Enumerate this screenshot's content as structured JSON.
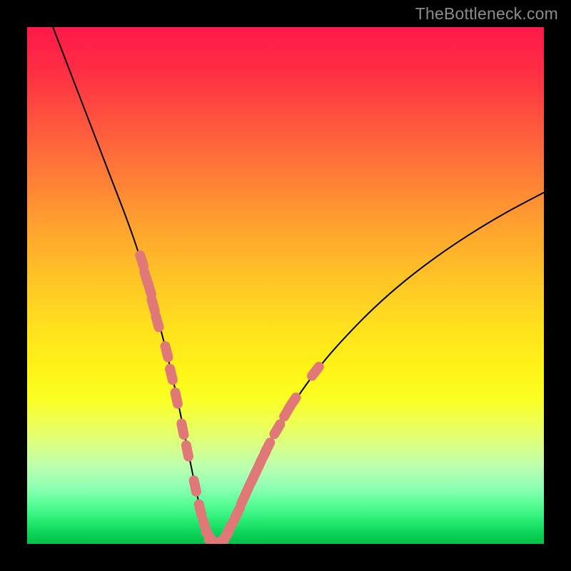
{
  "watermark": "TheBottleneck.com",
  "colors": {
    "curve_stroke": "#000000",
    "marker_fill": "#e07878",
    "marker_stroke": "#e07878"
  },
  "chart_data": {
    "type": "line",
    "title": "",
    "xlabel": "",
    "ylabel": "",
    "xlim": [
      0,
      100
    ],
    "ylim": [
      0,
      100
    ],
    "series": [
      {
        "name": "curve",
        "x": [
          5,
          7,
          9,
          11,
          13,
          15,
          17,
          19,
          21,
          22.5,
          24,
          25.5,
          27,
          28.5,
          29.7,
          30.7,
          31.7,
          32.7,
          33.6,
          34.4,
          35.2,
          36,
          36.8,
          37.6,
          38.6,
          39.8,
          41.2,
          43,
          45,
          47.5,
          50.5,
          54,
          58,
          62.5,
          67.5,
          73,
          79,
          85.5,
          92.5,
          100
        ],
        "values": [
          100,
          94.8,
          89.6,
          84.4,
          79.2,
          74,
          68.8,
          63.6,
          58,
          53.2,
          48.2,
          42.8,
          37,
          30.6,
          25,
          20,
          15.2,
          10.4,
          6.4,
          3.6,
          1.6,
          0.6,
          0.2,
          0.6,
          1.8,
          4,
          7,
          11,
          15.4,
          20.4,
          25.6,
          30.8,
          36,
          41,
          46,
          50.8,
          55.4,
          59.8,
          64,
          68
        ]
      }
    ],
    "markers": [
      {
        "x": 22.2,
        "y": 54.8
      },
      {
        "x": 23.0,
        "y": 51.6
      },
      {
        "x": 23.7,
        "y": 49.4
      },
      {
        "x": 24.4,
        "y": 46.2
      },
      {
        "x": 25.2,
        "y": 43.0
      },
      {
        "x": 27.0,
        "y": 37.2
      },
      {
        "x": 27.9,
        "y": 32.8
      },
      {
        "x": 28.9,
        "y": 28.2
      },
      {
        "x": 30.1,
        "y": 22.2
      },
      {
        "x": 31.0,
        "y": 18.0
      },
      {
        "x": 32.5,
        "y": 11.2
      },
      {
        "x": 33.5,
        "y": 6.6
      },
      {
        "x": 34.4,
        "y": 3.4
      },
      {
        "x": 35.3,
        "y": 1.4
      },
      {
        "x": 36.2,
        "y": 0.4
      },
      {
        "x": 37.2,
        "y": 0.4
      },
      {
        "x": 38.2,
        "y": 1.2
      },
      {
        "x": 39.4,
        "y": 3.4
      },
      {
        "x": 40.7,
        "y": 6.0
      },
      {
        "x": 41.9,
        "y": 8.8
      },
      {
        "x": 42.8,
        "y": 10.8
      },
      {
        "x": 43.8,
        "y": 12.9
      },
      {
        "x": 44.8,
        "y": 15.0
      },
      {
        "x": 45.7,
        "y": 16.9
      },
      {
        "x": 46.5,
        "y": 18.6
      },
      {
        "x": 48.4,
        "y": 22.2
      },
      {
        "x": 50.3,
        "y": 25.6
      },
      {
        "x": 51.4,
        "y": 27.4
      },
      {
        "x": 55.8,
        "y": 33.4
      }
    ]
  }
}
